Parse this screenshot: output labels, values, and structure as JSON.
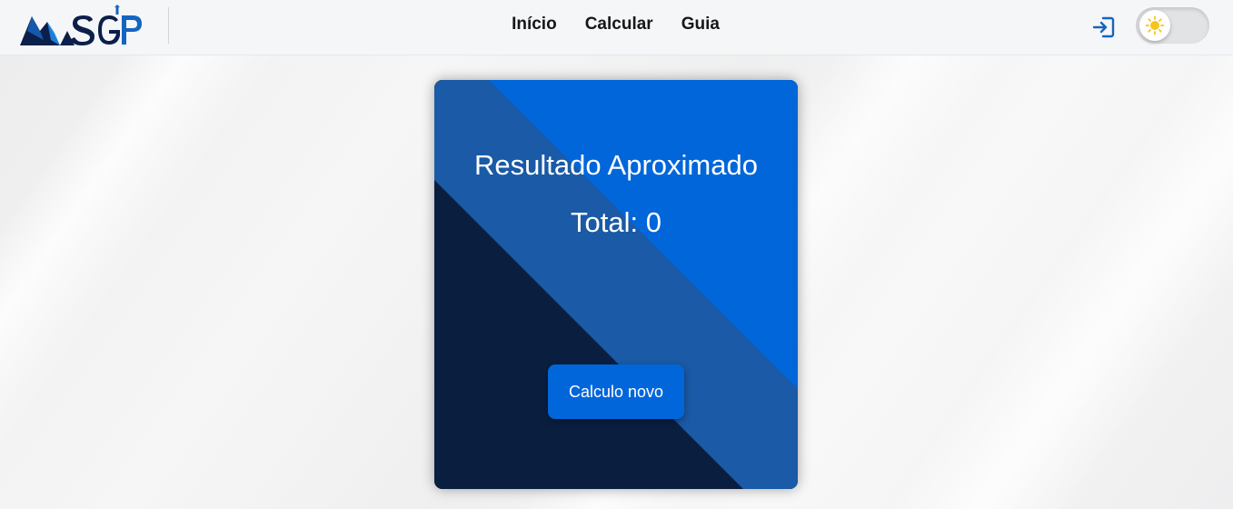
{
  "navbar": {
    "logo_text": "SGP",
    "links": [
      {
        "label": "Início"
      },
      {
        "label": "Calcular"
      },
      {
        "label": "Guia"
      }
    ],
    "login_icon": "login-icon",
    "theme_toggle_icon": "sun-icon"
  },
  "result_card": {
    "title": "Resultado Aproximado",
    "total": "Total: 0",
    "button_label": "Calculo novo"
  },
  "colors": {
    "accent": "#0066da",
    "card_mid": "#1a5aa6",
    "card_dark": "#0a1f40",
    "logo_dark": "#0c1f4a",
    "logo_blue": "#1565c0"
  }
}
